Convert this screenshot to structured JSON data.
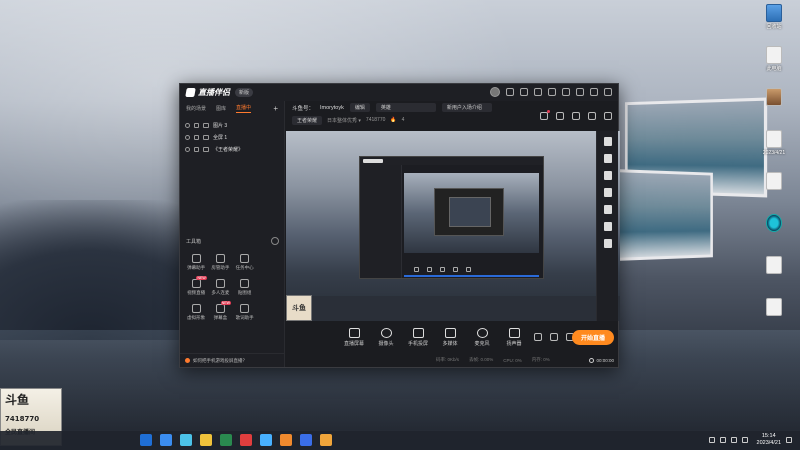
{
  "desktop": {
    "icons": [
      {
        "label": "回收站",
        "kind": "blue"
      },
      {
        "label": "此电脑",
        "kind": "plain"
      },
      {
        "label": "",
        "kind": "photo"
      },
      {
        "label": "2023/4/21",
        "kind": "plain"
      },
      {
        "label": "",
        "kind": "plain"
      },
      {
        "label": "",
        "kind": "teal"
      },
      {
        "label": "",
        "kind": "plain"
      },
      {
        "label": "",
        "kind": "plain"
      }
    ]
  },
  "app": {
    "title_tab": "新版",
    "left_tabs": [
      "我的场景",
      "图库",
      "直播中"
    ],
    "scenes": [
      {
        "name": "图片 3"
      },
      {
        "name": "全屏 1"
      },
      {
        "name": "《王者荣耀》"
      }
    ],
    "toolbox_title": "工具箱",
    "tools": [
      {
        "label": "弹幕助手",
        "badge": ""
      },
      {
        "label": "房管助手",
        "badge": ""
      },
      {
        "label": "任务中心",
        "badge": ""
      },
      {
        "label": "",
        "badge": ""
      },
      {
        "label": "视频直播",
        "badge": "NEW"
      },
      {
        "label": "多人连麦",
        "badge": ""
      },
      {
        "label": "贴图组",
        "badge": ""
      },
      {
        "label": "",
        "badge": ""
      },
      {
        "label": "虚拟形象",
        "badge": ""
      },
      {
        "label": "弹幕盒",
        "badge": "NEW"
      },
      {
        "label": "歌词助手",
        "badge": ""
      },
      {
        "label": "",
        "badge": ""
      }
    ],
    "tip": "如何把手机游戏投屏直播？",
    "room": {
      "name_prefix": "斗鱼号：",
      "name": "Imorytoyk",
      "edit": "编辑",
      "field1": "英雄",
      "field2": "新用户入场介绍",
      "row2_a": "王者荣耀",
      "row2_b": "日本整体优秀 ▾",
      "room_id": "7418770",
      "heat": "4"
    },
    "controls": [
      {
        "label": "直播屏幕"
      },
      {
        "label": "摄像头"
      },
      {
        "label": "手机投屏"
      },
      {
        "label": "多媒体"
      },
      {
        "label": "麦克风"
      },
      {
        "label": "扬声器"
      }
    ],
    "live_button": "开始直播",
    "status": [
      "码率: 0Kb/s",
      "丢帧: 0.00%",
      "CPU: 0%",
      "内存: 0%"
    ],
    "timer": "00:00:00"
  },
  "overlay": {
    "big": "斗鱼",
    "number": "7418770",
    "tag": "全民直播间"
  },
  "taskbar": {
    "time": "15:14",
    "date": "2023/4/21",
    "apps": [
      "#1f6fd6",
      "#3b8df0",
      "#4cc2e8",
      "#f0c23b",
      "#2a8a4f",
      "#e03e3e",
      "#48b0ff",
      "#f08a2e",
      "#3a6ee8",
      "#f0a53b"
    ]
  }
}
